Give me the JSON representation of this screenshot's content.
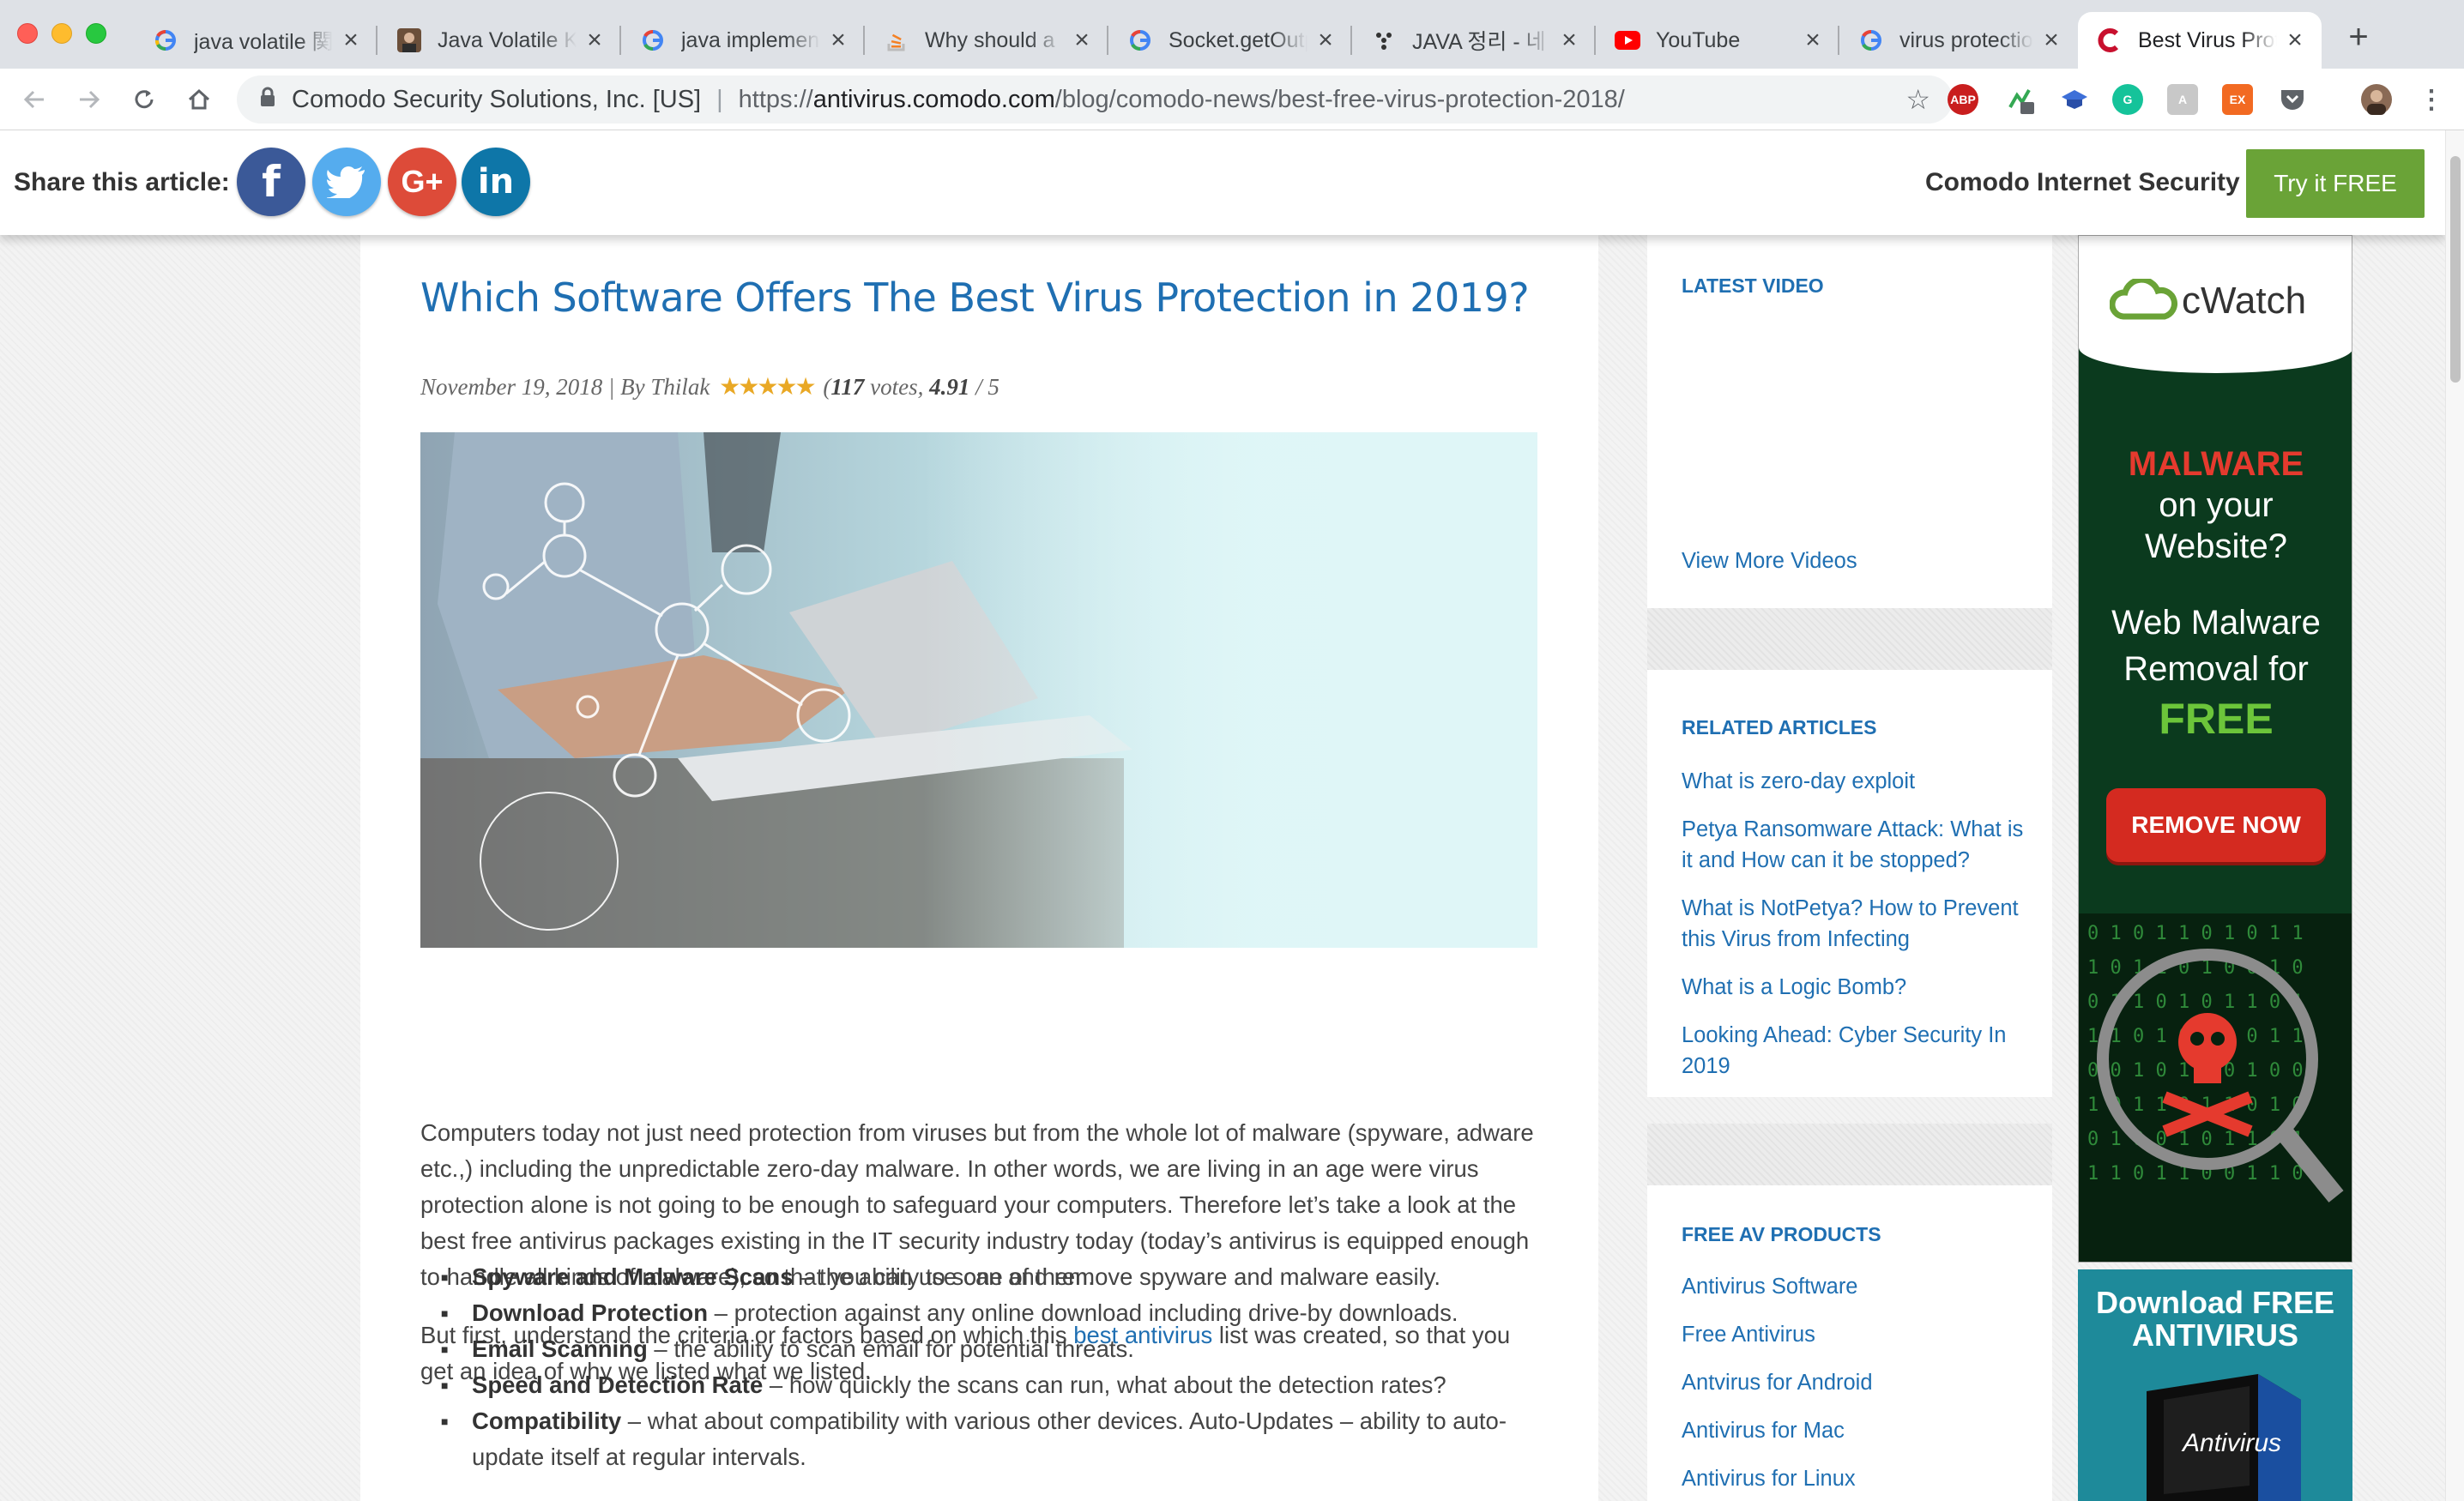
{
  "tabs": [
    {
      "title": "java volatile 関",
      "favicon": "google"
    },
    {
      "title": "Java Volatile Keyword",
      "favicon": "avatar"
    },
    {
      "title": "java implements",
      "favicon": "google"
    },
    {
      "title": "Why should a",
      "favicon": "stackoverflow"
    },
    {
      "title": "Socket.getOutputStream",
      "favicon": "google"
    },
    {
      "title": "JAVA 정리 - 네",
      "favicon": "dots"
    },
    {
      "title": "YouTube",
      "favicon": "youtube"
    },
    {
      "title": "virus protection",
      "favicon": "google"
    },
    {
      "title": "Best Virus Protection",
      "favicon": "comodo",
      "active": true
    }
  ],
  "address": {
    "owner": "Comodo Security Solutions, Inc. [US]",
    "protocol": "https://",
    "host": "antivirus.comodo.com",
    "path": "/blog/comodo-news/best-free-virus-protection-2018/"
  },
  "extensions": [
    {
      "name": "adblock-plus-icon",
      "label": "ABP",
      "color": "#c91e1e"
    },
    {
      "name": "extension-badge-icon",
      "label": "0",
      "color": "#34a853"
    },
    {
      "name": "graduation-cap-icon",
      "label": "",
      "color": "#3d6fd8"
    },
    {
      "name": "grammarly-icon",
      "label": "G",
      "color": "#15c39a"
    },
    {
      "name": "translate-icon",
      "label": "",
      "color": "#b0b0b0"
    },
    {
      "name": "ex-icon",
      "label": "EX",
      "color": "#f26a22"
    },
    {
      "name": "pocket-icon",
      "label": "",
      "color": "#5f6368"
    }
  ],
  "sharebar": {
    "label": "Share this article:",
    "product": "Comodo Internet Security",
    "cta": "Try it FREE"
  },
  "article": {
    "title": "Which Software Offers The Best Virus Protection in 2019?",
    "date_author": "November 19, 2018 | By Thilak",
    "votes": "117",
    "rating": "4.91",
    "rating_max": "5",
    "rating_value": 4.91,
    "para1": "Computers today not just need protection from viruses but from the whole lot of malware (spyware, adware etc.,) including the unpredictable zero-day malware. In other words, we are living in an age were virus protection alone is not going to be enough to safeguard your computers. Therefore let’s take a look at the best free antivirus packages existing in the IT security industry today (today’s antivirus is equipped enough to handle all kinds of malware), so that you can use one of them.",
    "para2_before": "But first, understand the criteria or factors based on which this ",
    "para2_link": "best antivirus",
    "para2_after": " list was created, so that you get an idea of why we listed what we listed.",
    "bullets": [
      {
        "bold": "Spyware and ",
        "link": "Malware Scans",
        "text": " – the ability to scan and remove spyware and malware easily."
      },
      {
        "bold": "Download Protection",
        "link": "",
        "text": " – protection against any online download including drive-by downloads."
      },
      {
        "bold": "Email Scanning",
        "link": "",
        "text": " – the ability to scan email for potential threats."
      },
      {
        "bold": "Speed and Detection Rate",
        "link": "",
        "text": " – how quickly the scans can run, what about the detection rates?"
      },
      {
        "bold": "Compatibility",
        "link": "",
        "text": " – what about compatibility with various other devices. Auto-Updates – ability to auto-update itself at regular intervals."
      }
    ]
  },
  "sidebar": {
    "latest_video": {
      "heading": "LATEST VIDEO",
      "link": "View More Videos"
    },
    "related": {
      "heading": "RELATED ARTICLES",
      "links": [
        "What is zero-day exploit",
        "Petya Ransomware Attack: What is it and How can it be stopped?",
        "What is NotPetya? How to Prevent this Virus from Infecting",
        "What is a Logic Bomb?",
        "Looking Ahead: Cyber Security In 2019"
      ]
    },
    "free_av": {
      "heading": "FREE AV PRODUCTS",
      "links": [
        "Antivirus Software",
        "Free Antivirus",
        "Antvirus for Android",
        "Antivirus for Mac",
        "Antivirus for Linux"
      ]
    }
  },
  "ads": {
    "cwatch": {
      "brand": "cWatch",
      "line1": "MALWARE",
      "line2": "on your Website?",
      "line3": "Web Malware Removal for",
      "line4": "FREE",
      "button": "REMOVE NOW"
    },
    "download": {
      "line1": "Download FREE",
      "line2": "ANTIVIRUS",
      "box": "Antivirus"
    }
  },
  "colors": {
    "link": "#1f6fb2",
    "cta": "#6aa337",
    "facebook": "#3b5998",
    "twitter": "#55acee",
    "googleplus": "#dd4b39",
    "linkedin": "#0e76a8"
  }
}
